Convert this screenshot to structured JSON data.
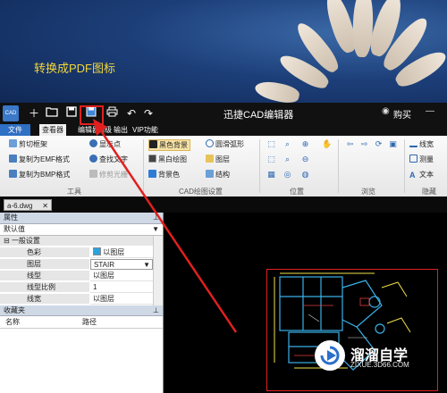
{
  "banner": {
    "caption": "转换成PDF图标"
  },
  "app": {
    "logo_text": "CAD",
    "title": "迅捷CAD编辑器",
    "buy_label": "购买",
    "menu_tabs": [
      "文件",
      "查看器",
      "编辑器",
      "高级",
      "输出",
      "VIP功能"
    ],
    "active_tab": "查看器"
  },
  "ribbon": {
    "tools": {
      "items": [
        "剪切框架",
        "复制为EMF格式",
        "复制为BMP格式",
        "显示点",
        "查找文字",
        "修剪光栅"
      ],
      "group_label": "工具"
    },
    "cad_settings": {
      "items": [
        "黑色背景",
        "黑白绘图",
        "背景色",
        "圆滑弧形",
        "图层",
        "结构"
      ],
      "group_label": "CAD绘图设置"
    },
    "position": {
      "group_label": "位置"
    },
    "browse": {
      "group_label": "浏览"
    },
    "hide": {
      "items": [
        "线宽",
        "测量",
        "文本"
      ],
      "group_label": "隐藏"
    }
  },
  "document": {
    "tab_label": "a-6.dwg"
  },
  "properties": {
    "header": "属性",
    "selector": "默认值",
    "section": "一般设置",
    "rows": [
      {
        "name": "色彩",
        "value": "以图层"
      },
      {
        "name": "图层",
        "value": "STAIR"
      },
      {
        "name": "线型",
        "value": "以图层"
      },
      {
        "name": "线型比例",
        "value": "1"
      },
      {
        "name": "线宽",
        "value": "以图层"
      }
    ]
  },
  "favorites": {
    "header": "收藏夹",
    "columns": [
      "名称",
      "路径"
    ]
  },
  "watermark": {
    "name": "溜溜自学",
    "url": "ZIXUE.3D66.COM"
  },
  "colors": {
    "highlight": "#e02020",
    "accent": "#2f6fc4",
    "title_bg": "#111111"
  }
}
